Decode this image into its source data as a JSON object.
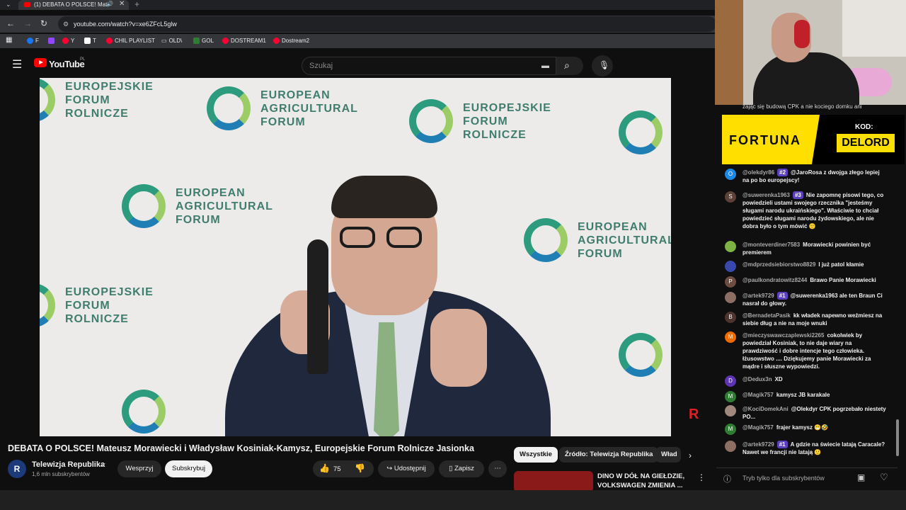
{
  "browser": {
    "tab_title": "(1) DEBATA O POLSCE! Mat",
    "url": "youtube.com/watch?v=xe6ZFcL5glw",
    "bookmarks": [
      "F",
      "Y",
      "T",
      "CHIL PLAYLIST",
      "OLD\\",
      "GOL",
      "DOSTREAM1",
      "Dostream2"
    ]
  },
  "youtube": {
    "logo": "YouTube",
    "logo_region": "PL",
    "search_placeholder": "Szukaj"
  },
  "video": {
    "backdrop_texts": [
      "EUROPEAN\nAGRICULTURAL\nFORUM",
      "EUROPEJSKIE\nFORUM\nROLNICZE"
    ],
    "title": "DEBATA O POLSCE! Mateusz Morawiecki i Władysław Kosiniak-Kamysz, Europejskie Forum Rolnicze Jasionka",
    "channel": "Telewizja Republika",
    "subscribers": "1,6 mln subskrybentów",
    "support_label": "Wesprzyj",
    "subscribe_label": "Subskrybuj",
    "likes": "75",
    "share_label": "Udostępnij",
    "save_label": "Zapisz"
  },
  "chips": [
    "Wszystkie",
    "Źródło: Telewizja Republika",
    "Wład"
  ],
  "recommended": {
    "title": "DINO W DÓŁ NA GIEŁDZIE, VOLKSWAGEN ZMIENIA ..."
  },
  "ad": {
    "brand": "FORTUNA",
    "kod_label": "KOD:",
    "code": "DELORD"
  },
  "chat": {
    "top_message": "zając się budową CPK a nie kociego domku ani",
    "messages": [
      {
        "author": "@olekdyr86",
        "badge": "#2",
        "text": "@JaroRosa z dwojga złego lepiej na po bo europejscy!",
        "initial": "O",
        "color": "#1e88e5"
      },
      {
        "author": "@suwerenka1963",
        "badge": "#3",
        "text": "Nie zapomnę pisowi tego, co powiedzieli ustami swojego rzecznika \"jesteśmy sługami narodu ukraińskiego\". Właściwie to chciał powiedzieć sługami narodu żydowskiego, ale nie dobra było o tym mówić 🙂",
        "initial": "S",
        "color": "#5d4037"
      },
      {
        "author": "@monteverdiner7583",
        "badge": "",
        "text": "Morawiecki powinien być premierem",
        "initial": "",
        "color": "#7cb342"
      },
      {
        "author": "@mdprzedsiebiorstwo8829",
        "badge": "",
        "text": "I już patol kłamie",
        "initial": "",
        "color": "#3949ab"
      },
      {
        "author": "@paulkondratowitz8244",
        "badge": "",
        "text": "Brawo Panie Morawiecki",
        "initial": "P",
        "color": "#6d4c41"
      },
      {
        "author": "@artek9729",
        "badge": "#1",
        "text": "@suwerenka1963 ale ten Braun Ci nasrał do głowy.",
        "initial": "",
        "color": "#8d6e63"
      },
      {
        "author": "@BernadetaPasik",
        "badge": "",
        "text": "kk władek napewno weźmiesz na siebie dług a nie na moje wnuki",
        "initial": "B",
        "color": "#4e342e"
      },
      {
        "author": "@mieczyswawczaplewski2265",
        "badge": "",
        "text": "cokolwiek by powiedział Kosiniak, to nie daje wiary na prawdziwość i dobre intencje tego człowieka. łżusowstwo .... Dziękujemy panie Morawiecki za mądre i słuszne wypowiedzi.",
        "initial": "M",
        "color": "#ef6c00"
      },
      {
        "author": "@Dedux3n",
        "badge": "",
        "text": "XD",
        "initial": "D",
        "color": "#5e35b1"
      },
      {
        "author": "@Magik757",
        "badge": "",
        "text": "kamysz JB karakale",
        "initial": "M",
        "color": "#2e7d32"
      },
      {
        "author": "@KociDomekAni",
        "badge": "",
        "text": "@Olekdyr CPK pogrzebało niestety PO...",
        "initial": "",
        "color": "#a1887f"
      },
      {
        "author": "@Magik757",
        "badge": "",
        "text": "frajer kamysz 😁🤣",
        "initial": "M",
        "color": "#2e7d32"
      },
      {
        "author": "@artek9729",
        "badge": "#1",
        "text": "A gdzie na świecie latają Caracale? Nawet we francji nie latają 🙂",
        "initial": "",
        "color": "#8d6e63"
      }
    ],
    "input_placeholder": "Tryb tylko dla subskrybentów"
  }
}
